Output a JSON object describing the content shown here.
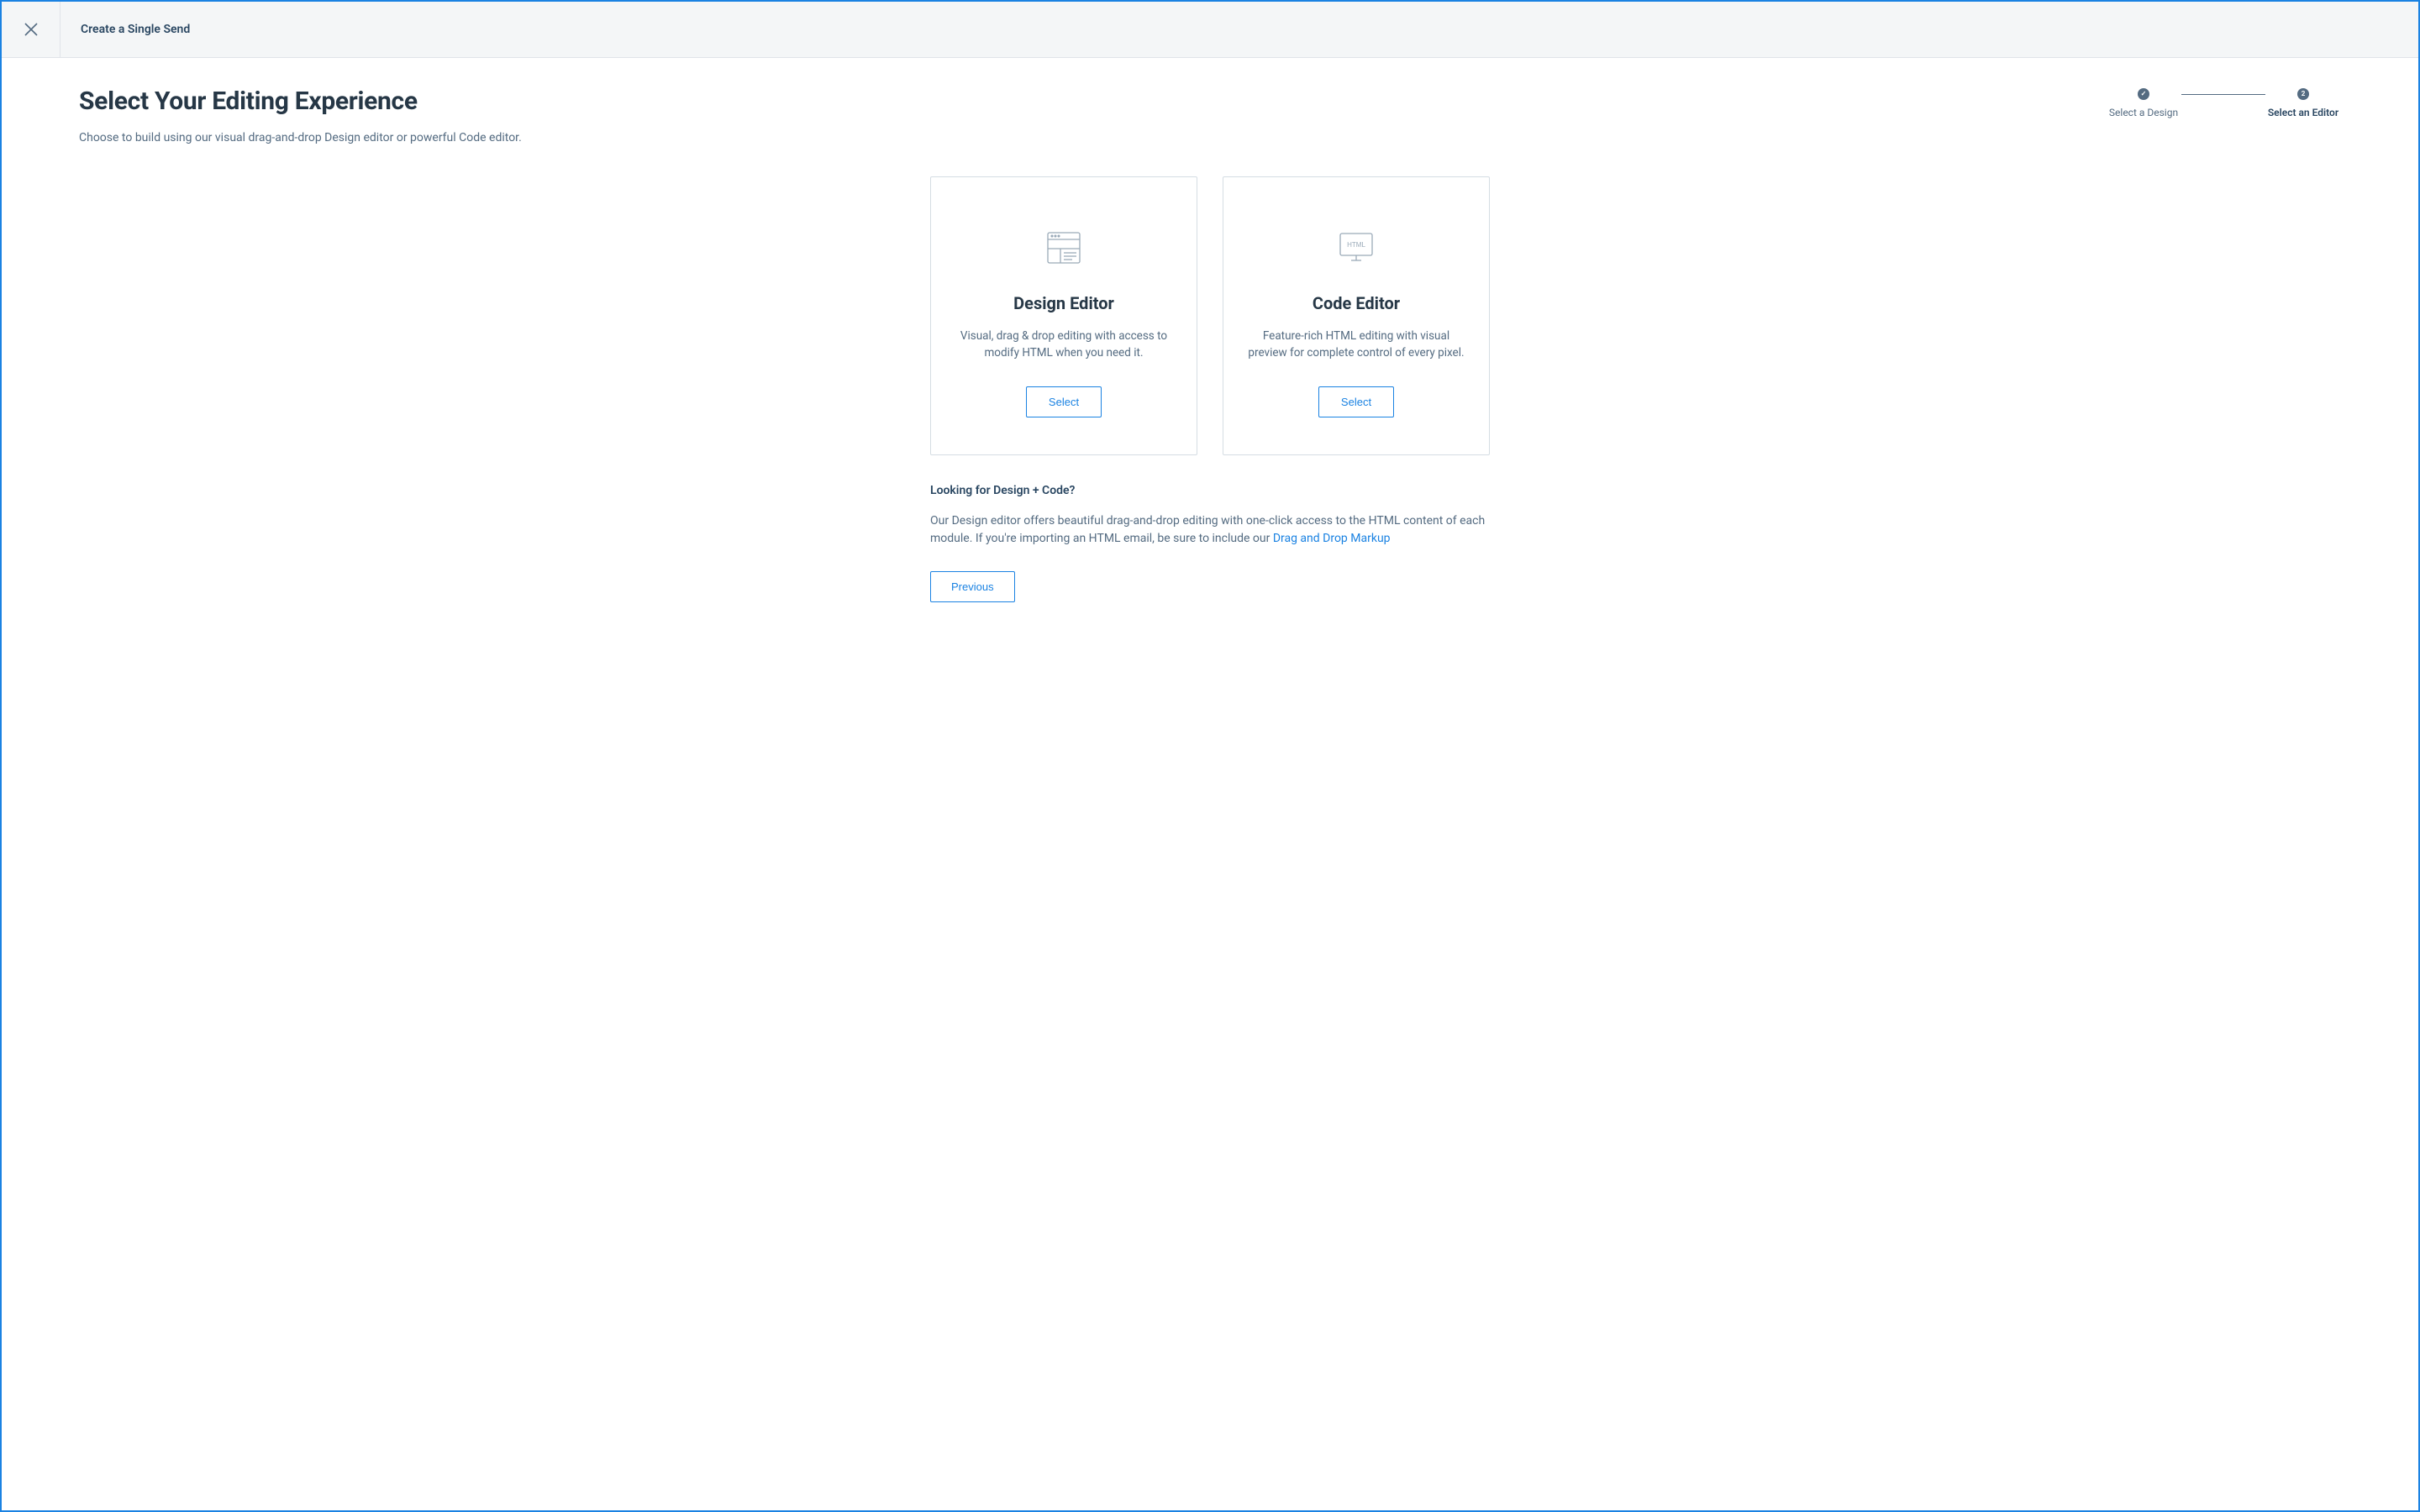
{
  "header": {
    "title": "Create a Single Send"
  },
  "page": {
    "heading": "Select Your Editing Experience",
    "subheading": "Choose to build using our visual drag-and-drop Design editor or powerful Code editor."
  },
  "stepper": {
    "step1_label": "Select a Design",
    "step2_number": "2",
    "step2_label": "Select an Editor"
  },
  "cards": {
    "design": {
      "title": "Design Editor",
      "desc": "Visual, drag & drop editing with access to modify HTML when you need it.",
      "button": "Select"
    },
    "code": {
      "title": "Code Editor",
      "icon_text": "HTML",
      "desc": "Feature-rich HTML editing with visual preview for complete control of every pixel.",
      "button": "Select"
    }
  },
  "below": {
    "title": "Looking for Design + Code?",
    "text_part1": "Our Design editor offers beautiful drag-and-drop editing with one-click access to the HTML content of each module. If you're importing an HTML email, be sure to include our ",
    "link_text": "Drag and Drop Markup",
    "previous": "Previous"
  }
}
